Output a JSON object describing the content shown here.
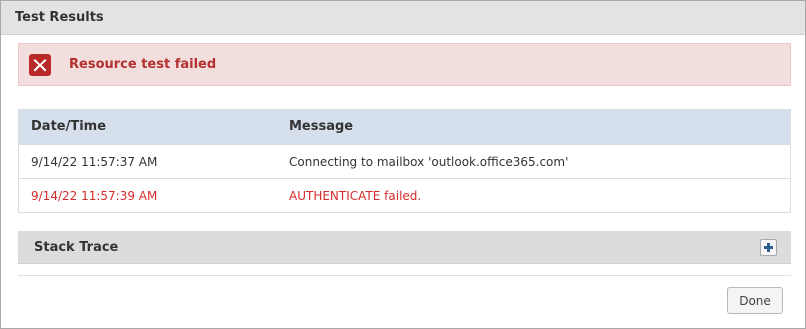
{
  "dialog": {
    "title": "Test Results"
  },
  "alert": {
    "message": "Resource test failed",
    "icon": "error-x-icon",
    "color": "#b3312e"
  },
  "table": {
    "headers": {
      "datetime": "Date/Time",
      "message": "Message"
    },
    "rows": [
      {
        "datetime": "9/14/22 11:57:37 AM",
        "message": "Connecting to mailbox 'outlook.office365.com'",
        "status": "normal"
      },
      {
        "datetime": "9/14/22 11:57:39 AM",
        "message": "AUTHENTICATE failed.",
        "status": "error"
      }
    ]
  },
  "stack_trace": {
    "title": "Stack Trace",
    "expand_icon": "plus-icon"
  },
  "footer": {
    "done_label": "Done"
  }
}
